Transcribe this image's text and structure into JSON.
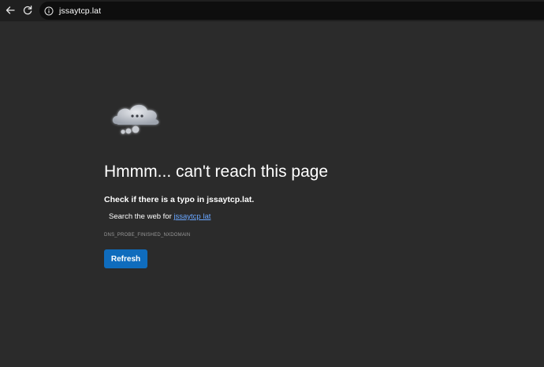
{
  "browser": {
    "url": "jssaytcp.lat",
    "back_icon": "arrow-left-icon",
    "reload_icon": "refresh-icon",
    "site_info_icon": "info-circle-icon"
  },
  "error_page": {
    "illustration_icon": "cloud-thinking-icon",
    "title": "Hmmm... can't reach this page",
    "hint": "Check if there is a typo in jssaytcp.lat.",
    "search_prefix": "Search the web for ",
    "search_link": "jssaytcp lat",
    "error_code": "DNS_PROBE_FINISHED_NXDOMAIN",
    "refresh_label": "Refresh"
  },
  "colors": {
    "background": "#2b2b2b",
    "toolbar": "#1f1f1f",
    "address_bar": "#0e0e0e",
    "link": "#69a6ff",
    "button": "#0f6cbd"
  }
}
